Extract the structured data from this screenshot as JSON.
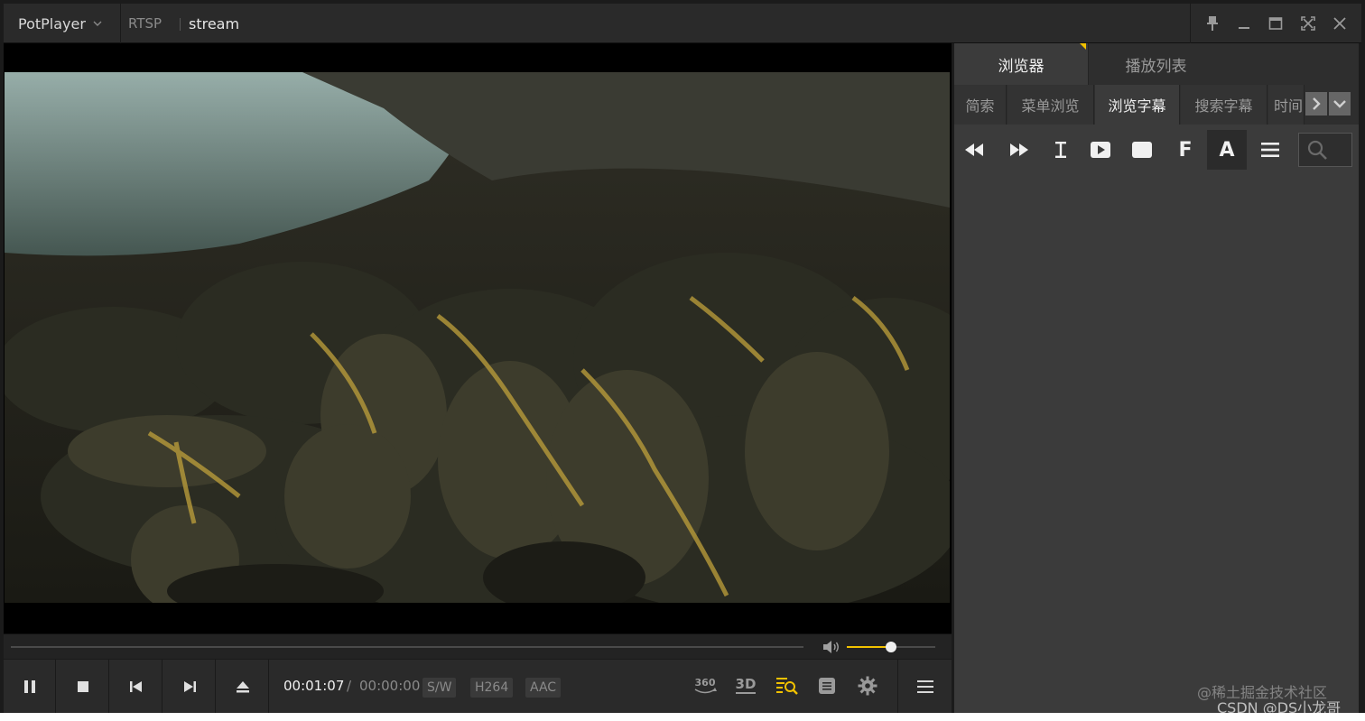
{
  "titlebar": {
    "app_name": "PotPlayer",
    "protocol": "RTSP",
    "stream_title": "stream",
    "icons": [
      "pin-icon",
      "minimize-icon",
      "maximize-icon",
      "fullscreen-icon",
      "close-icon"
    ]
  },
  "video": {
    "scene": "marine iguanas on dark volcanic rocks"
  },
  "seekbar": {
    "volume_fraction": 0.5
  },
  "controls": {
    "buttons": [
      "pause-icon",
      "stop-icon",
      "previous-icon",
      "next-icon",
      "eject-icon"
    ],
    "time_current": "00:01:07",
    "time_separator": "/",
    "time_total": "00:00:00",
    "badge_decoder": "S/W",
    "badge_video_codec": "H264",
    "badge_audio_codec": "AAC",
    "right_buttons": {
      "vr360": "360",
      "three_d": "3D"
    }
  },
  "panel": {
    "main_tabs": [
      {
        "label": "浏览器",
        "active": true
      },
      {
        "label": "播放列表",
        "active": false
      }
    ],
    "sub_tabs": [
      {
        "label": "简索",
        "active": false
      },
      {
        "label": "菜单浏览",
        "active": false
      },
      {
        "label": "浏览字幕",
        "active": true
      },
      {
        "label": "搜索字幕",
        "active": false
      },
      {
        "label": "时间",
        "active": false
      }
    ],
    "tools": {
      "f_label": "F",
      "a_label": "A"
    }
  },
  "watermark": {
    "line1": "@稀土掘金技术社区",
    "line2": "CSDN @DS小龙哥"
  },
  "colors": {
    "accent": "#f2c200",
    "panel_bg": "#3b3b3b",
    "titlebar_bg": "#2a2a2a"
  }
}
